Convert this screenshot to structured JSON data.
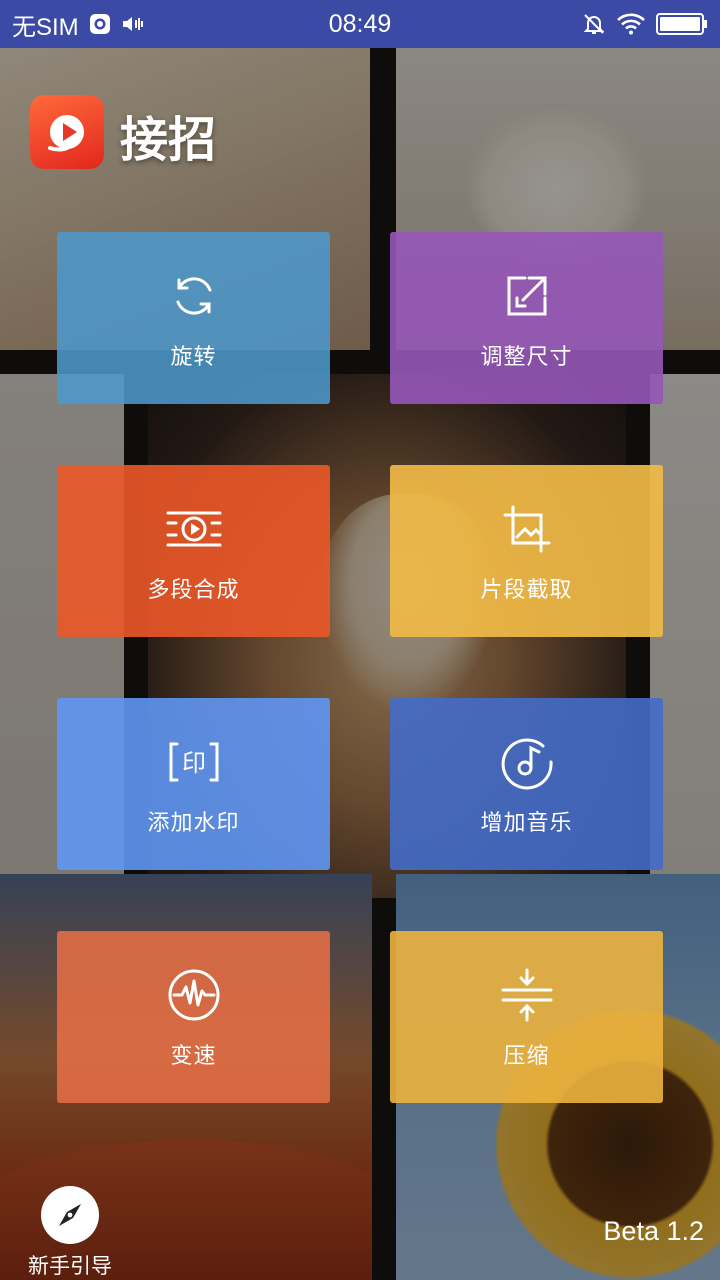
{
  "status_bar": {
    "carrier": "无SIM",
    "time": "08:49",
    "icons": [
      "sim-status-icon",
      "volume-icon",
      "mute-bell-icon",
      "wifi-icon",
      "battery-icon"
    ]
  },
  "header": {
    "app_name": "接招",
    "logo_icon": "play-logo-icon"
  },
  "features": [
    {
      "label": "旋转",
      "icon": "rotate-icon",
      "color": "#4d97cb"
    },
    {
      "label": "调整尺寸",
      "icon": "resize-icon",
      "color": "#9656b8"
    },
    {
      "label": "多段合成",
      "icon": "merge-video-icon",
      "color": "#eb5828"
    },
    {
      "label": "片段截取",
      "icon": "crop-icon",
      "color": "#f0ba46"
    },
    {
      "label": "添加水印",
      "icon": "watermark-icon",
      "color": "#5f96f2"
    },
    {
      "label": "增加音乐",
      "icon": "music-disc-icon",
      "color": "#446cc8"
    },
    {
      "label": "变速",
      "icon": "speed-wave-icon",
      "color": "#e46e46"
    },
    {
      "label": "压缩",
      "icon": "compress-icon",
      "color": "#ecb23e"
    }
  ],
  "footer": {
    "guide_label": "新手引导",
    "guide_icon": "compass-icon",
    "version": "Beta 1.2"
  }
}
